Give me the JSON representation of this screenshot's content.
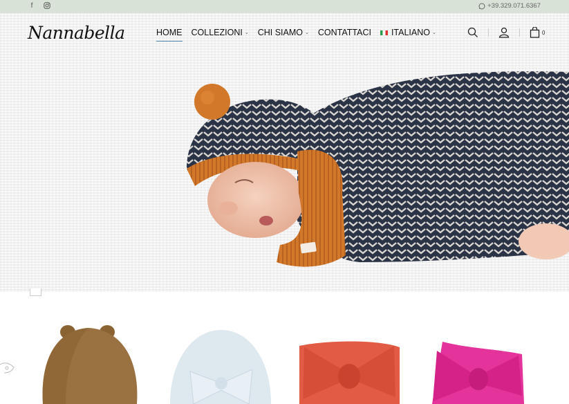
{
  "topbar": {
    "social": [
      "facebook-icon",
      "instagram-icon"
    ],
    "phone": "+39.329.071.6367"
  },
  "brand": {
    "logo_text": "Nannabella"
  },
  "nav": {
    "items": [
      {
        "label": "HOME",
        "active": true,
        "dropdown": false
      },
      {
        "label": "COLLEZIONI",
        "active": false,
        "dropdown": true
      },
      {
        "label": "CHI SIAMO",
        "active": false,
        "dropdown": true
      },
      {
        "label": "CONTATTACI",
        "active": false,
        "dropdown": false
      },
      {
        "label": "ITALIANO",
        "active": false,
        "dropdown": true
      }
    ]
  },
  "tools": {
    "cart_count": "0",
    "icons": [
      "search-icon",
      "user-icon",
      "shopping-bag-icon"
    ]
  },
  "colors": {
    "topbar": "#d8e2d6",
    "accent": "#4a7fa8",
    "knit_navy": "#2b3346",
    "knit_orange": "#d2782a"
  },
  "products": [
    "brown bear hat",
    "light blue bow hat",
    "coral bow headband",
    "pink bow headband"
  ]
}
